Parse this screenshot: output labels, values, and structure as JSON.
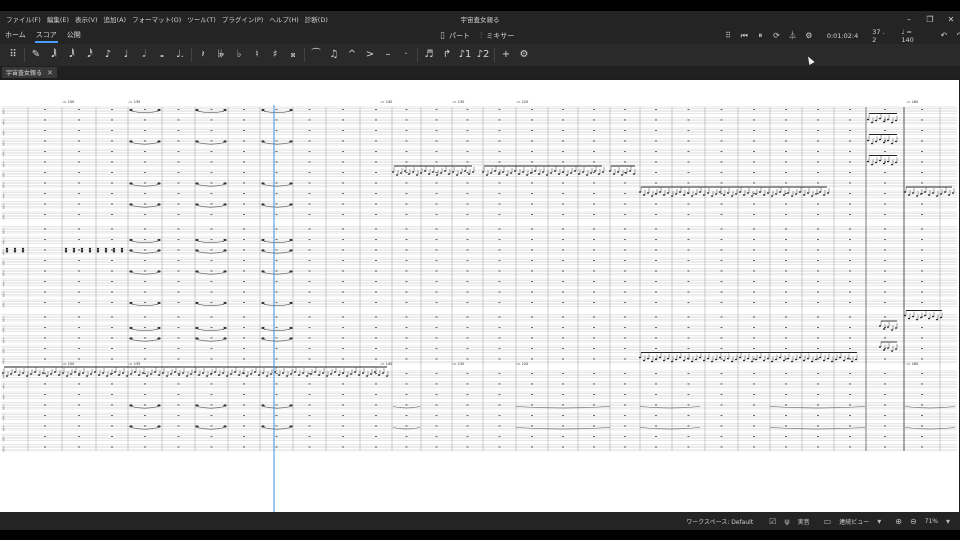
{
  "window": {
    "title": "宇宙査女親る"
  },
  "menubar": [
    "ファイル(F)",
    "編集(E)",
    "表示(V)",
    "追加(A)",
    "フォーマット(O)",
    "ツール(T)",
    "プラグイン(P)",
    "ヘルプ(H)",
    "診断(D)"
  ],
  "nav_tabs": [
    "ホーム",
    "スコア",
    "公開"
  ],
  "center_tools": {
    "parts": "パート",
    "mixer": "ミキサー"
  },
  "playback": {
    "time": "0:01:02:4",
    "position": "37 . 2",
    "tempo": "♩ = 140"
  },
  "note_input_toolbar": {
    "items": [
      {
        "name": "grip-icon",
        "glyph": "⠿"
      },
      {
        "name": "pencil-icon",
        "glyph": "✎"
      },
      {
        "name": "64th-note-icon",
        "glyph": "𝅘𝅥𝅲"
      },
      {
        "name": "32nd-note-icon",
        "glyph": "𝅘𝅥𝅱"
      },
      {
        "name": "16th-note-icon",
        "glyph": "𝅘𝅥𝅰"
      },
      {
        "name": "eighth-note-icon",
        "glyph": "♪"
      },
      {
        "name": "quarter-note-icon",
        "glyph": "♩"
      },
      {
        "name": "half-note-icon",
        "glyph": "𝅗𝅥"
      },
      {
        "name": "whole-note-icon",
        "glyph": "𝅝"
      },
      {
        "name": "dot-icon",
        "glyph": "♩."
      },
      {
        "name": "rest-icon",
        "glyph": "𝄽"
      },
      {
        "name": "double-flat-icon",
        "glyph": "𝄫"
      },
      {
        "name": "flat-icon",
        "glyph": "♭"
      },
      {
        "name": "natural-icon",
        "glyph": "♮"
      },
      {
        "name": "sharp-icon",
        "glyph": "♯"
      },
      {
        "name": "double-sharp-icon",
        "glyph": "𝄪"
      },
      {
        "name": "tie-icon",
        "glyph": "⁀"
      },
      {
        "name": "slur-icon",
        "glyph": "♫"
      },
      {
        "name": "marcato-icon",
        "glyph": "^"
      },
      {
        "name": "accent-icon",
        "glyph": ">"
      },
      {
        "name": "tenuto-icon",
        "glyph": "–"
      },
      {
        "name": "staccato-icon",
        "glyph": "·"
      },
      {
        "name": "tuplet-icon",
        "glyph": "♬"
      },
      {
        "name": "flip-icon",
        "glyph": "↱"
      },
      {
        "name": "voice-1-icon",
        "glyph": "♪1"
      },
      {
        "name": "voice-2-icon",
        "glyph": "♪2"
      },
      {
        "name": "add-icon",
        "glyph": "+"
      },
      {
        "name": "settings-icon",
        "glyph": "⚙"
      }
    ]
  },
  "document_tab": {
    "label": "宇宙査女親る"
  },
  "score": {
    "tempo_marks": [
      "♩= 150",
      "♩= 135",
      "♩= 140",
      "♩= 130",
      "♩= 120",
      "♩= 160"
    ]
  },
  "statusbar": {
    "workspace": "ワークスペース: Default",
    "concert_pitch": "実音",
    "view_mode": "連続ビュー",
    "zoom": "71%"
  },
  "colors": {
    "accent": "#4a9eff",
    "playhead": "#3d8ee0",
    "score_bg": "#ffffff"
  }
}
